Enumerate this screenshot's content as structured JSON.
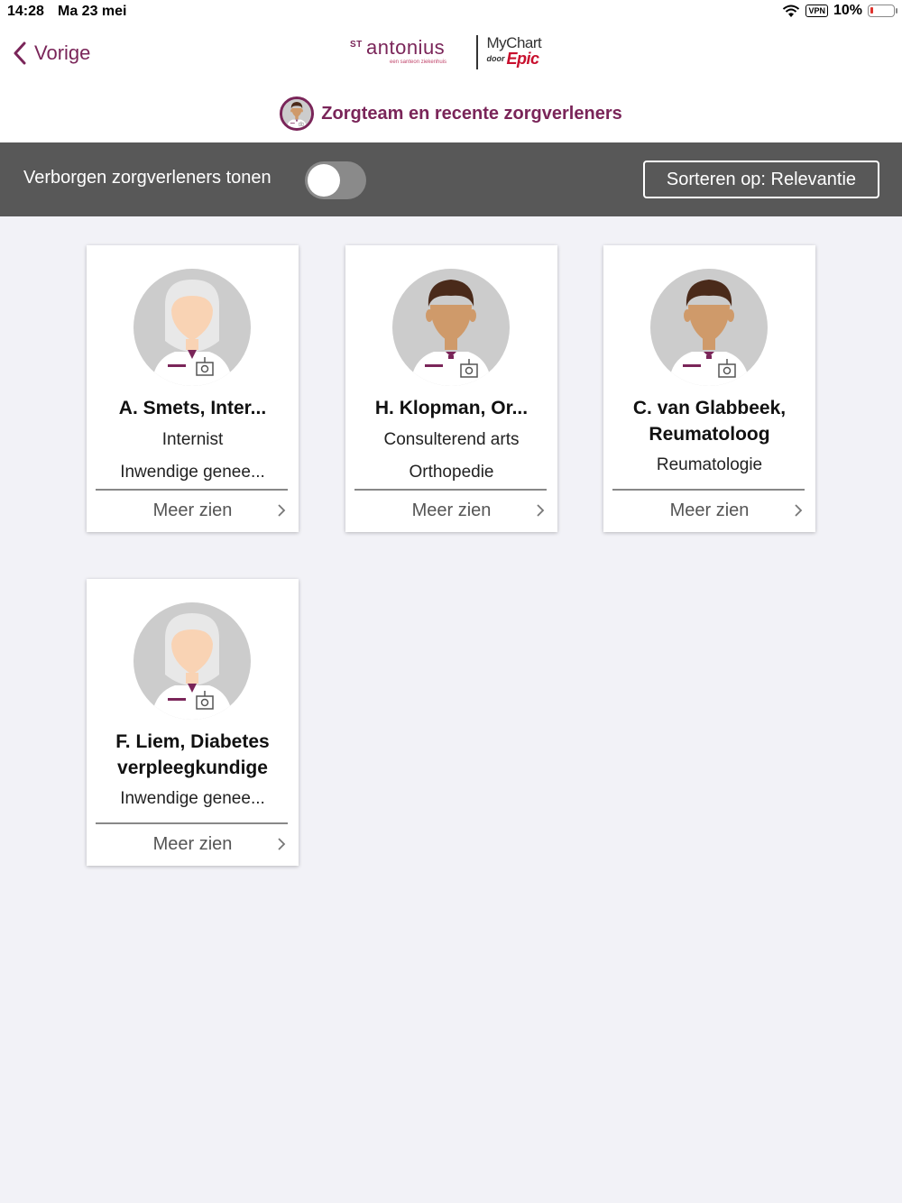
{
  "status_bar": {
    "time": "14:28",
    "date": "Ma 23 mei",
    "vpn": "VPN",
    "battery": "10%"
  },
  "nav": {
    "back_label": "Vorige"
  },
  "logos": {
    "st_sup": "ST",
    "st_name": "antonius",
    "st_tagline": "een santeon ziekenhuis",
    "mychart": "MyChart",
    "door": "door",
    "epic": "Epic"
  },
  "header": {
    "title": "Zorgteam en recente zorgverleners"
  },
  "toolbar": {
    "toggle_label": "Verborgen zorgverleners tonen",
    "toggle_on": false,
    "sort_label": "Sorteren op: Relevantie"
  },
  "colors": {
    "brand": "#7a2559",
    "toolbar_bg": "#585858",
    "page_bg": "#f2f2f7"
  },
  "providers": [
    {
      "name": "A. Smets, Inter...",
      "role": "Internist",
      "department": "Inwendige genee...",
      "more_label": "Meer zien",
      "avatar": "female-provider-icon"
    },
    {
      "name": "H. Klopman, Or...",
      "role": "Consulterend arts",
      "department": "Orthopedie",
      "more_label": "Meer zien",
      "avatar": "male-provider-icon"
    },
    {
      "name": "C. van Glabbeek, Reumatoloog",
      "role": "",
      "department": "Reumatologie",
      "more_label": "Meer zien",
      "avatar": "male-provider-icon"
    },
    {
      "name": "F. Liem, Diabetes verpleegkundige",
      "role": "",
      "department": "Inwendige genee...",
      "more_label": "Meer zien",
      "avatar": "female-provider-icon"
    }
  ]
}
